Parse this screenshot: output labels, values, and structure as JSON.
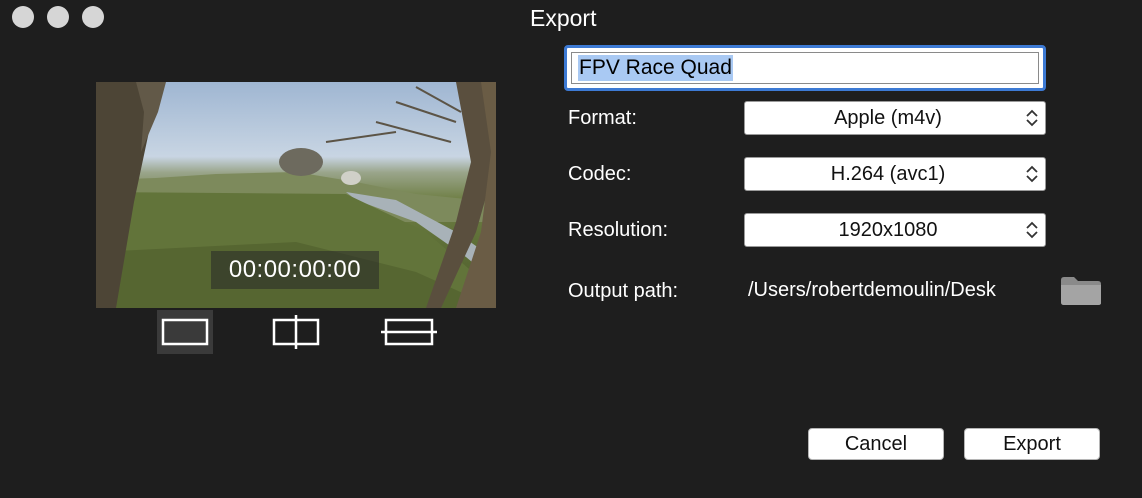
{
  "window": {
    "title": "Export"
  },
  "preview": {
    "timecode": "00:00:00:00"
  },
  "form": {
    "name_value": "FPV Race Quad",
    "format_label": "Format:",
    "format_value": "Apple (m4v)",
    "codec_label": "Codec:",
    "codec_value": "H.264 (avc1)",
    "resolution_label": "Resolution:",
    "resolution_value": "1920x1080",
    "output_label": "Output path:",
    "output_value": "/Users/robertdemoulin/Desk"
  },
  "buttons": {
    "cancel_label": "Cancel",
    "export_label": "Export"
  },
  "icons": {
    "view_modes": [
      "single-view-icon",
      "split-vertical-icon",
      "split-horizontal-icon"
    ],
    "folder": "folder-icon"
  },
  "colors": {
    "background": "#1e1e1e",
    "focus_ring": "#3d7ad4",
    "selection": "#a9c9f3",
    "selected_view": "#3a3a3a"
  }
}
